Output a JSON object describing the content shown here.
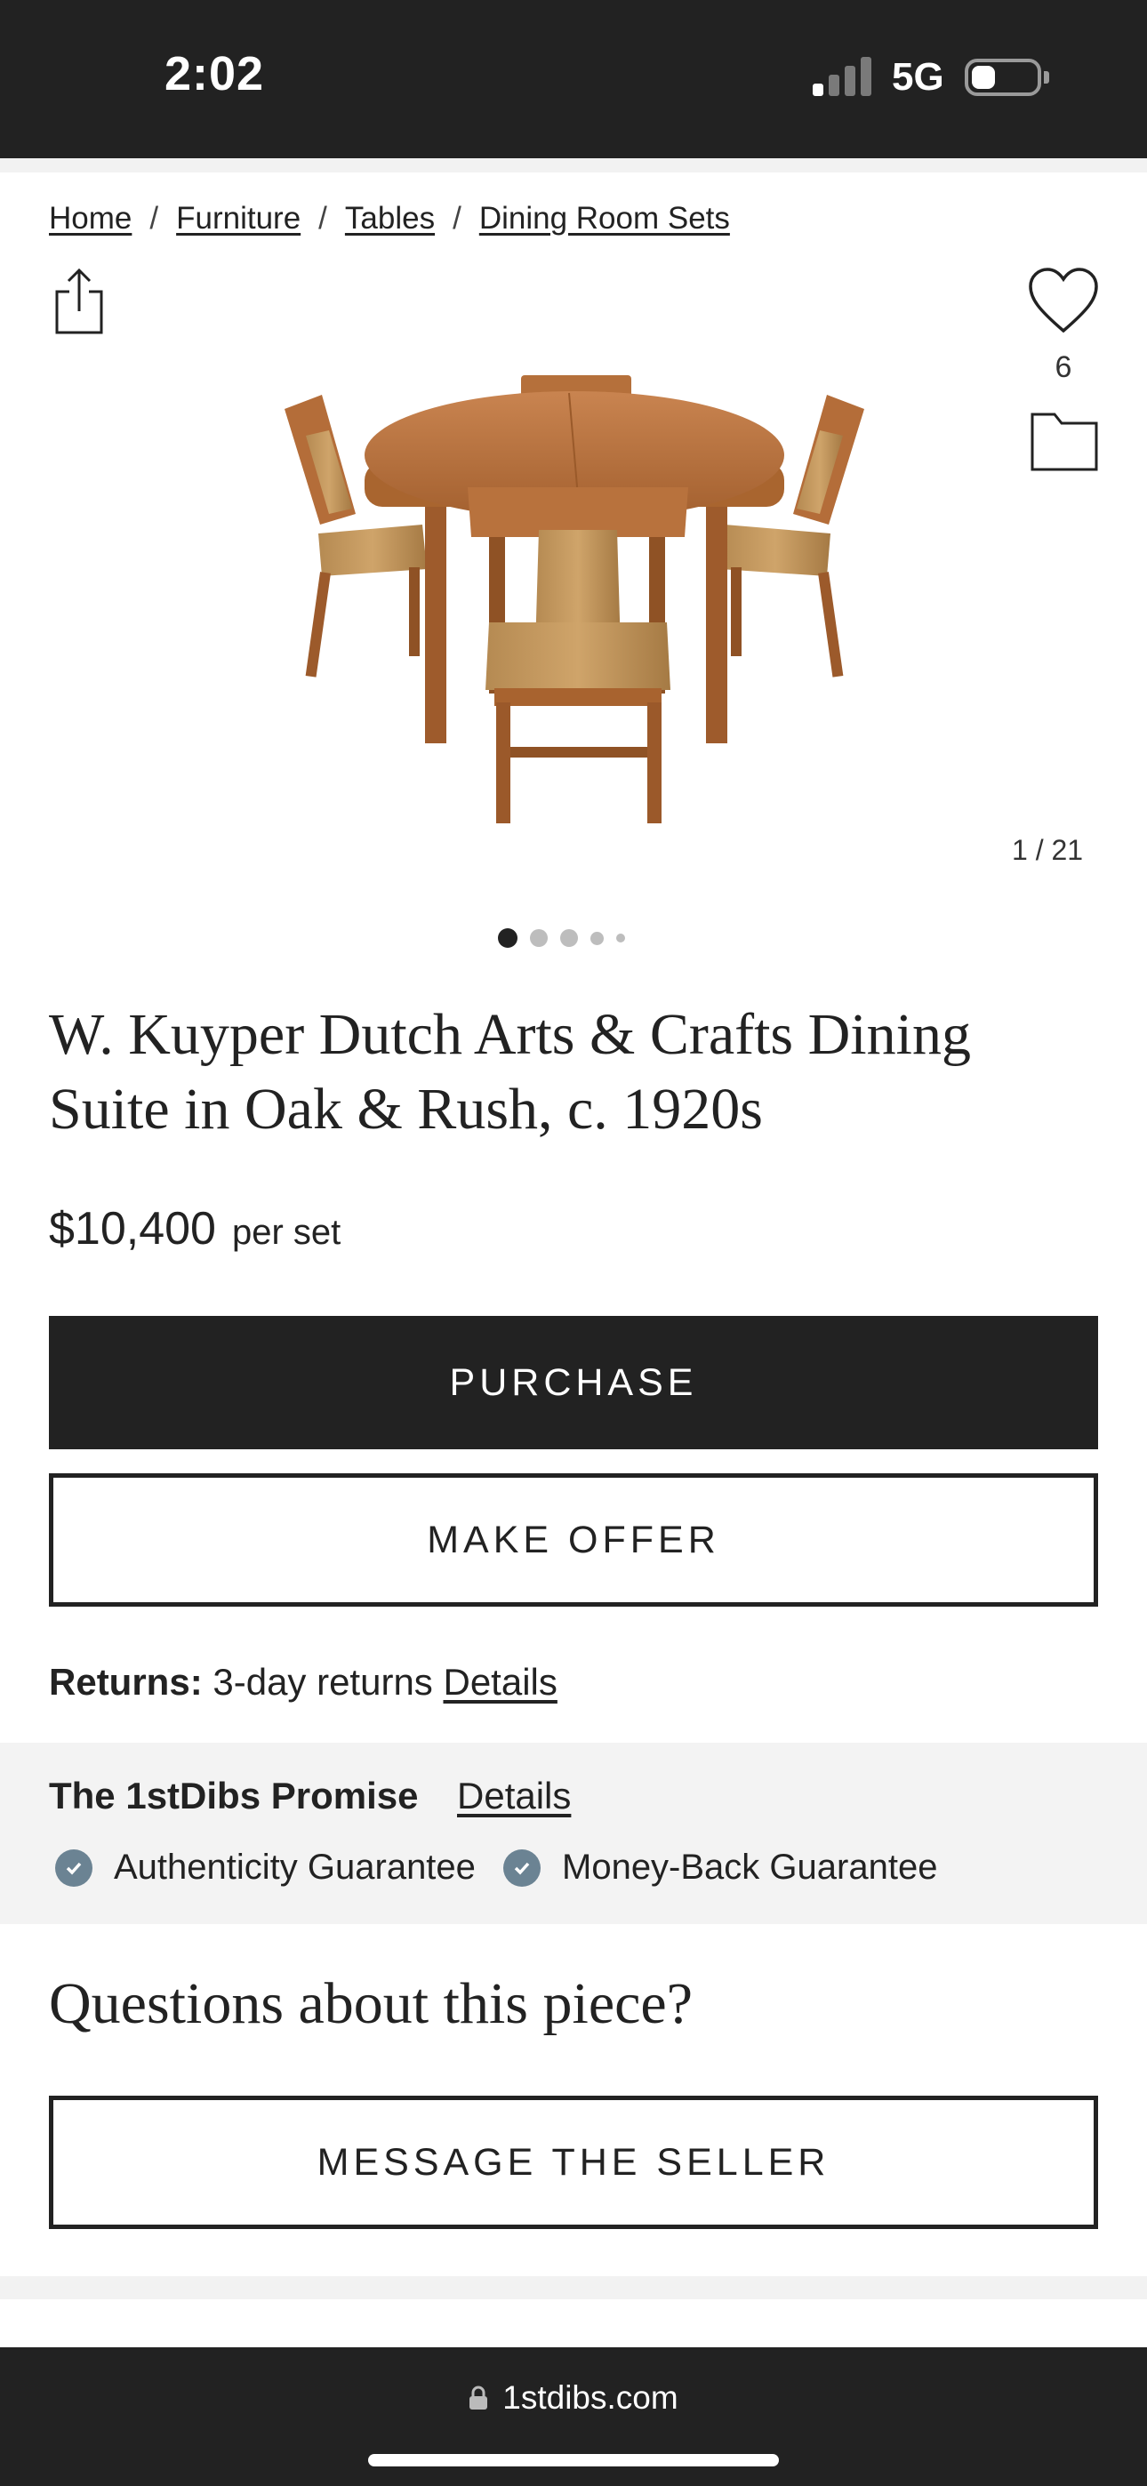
{
  "status_bar": {
    "time": "2:02",
    "network": "5G"
  },
  "breadcrumb": [
    "Home",
    "Furniture",
    "Tables",
    "Dining Room Sets"
  ],
  "breadcrumb_separator": "/",
  "gallery": {
    "favorites_count": "6",
    "image_counter": "1 / 21",
    "dots_count": 5,
    "active_dot": 1
  },
  "product": {
    "title": "W. Kuyper Dutch Arts & Crafts Dining Suite in Oak & Rush, c. 1920s",
    "price": "$10,400",
    "unit": "per set"
  },
  "actions": {
    "purchase": "PURCHASE",
    "offer": "MAKE OFFER",
    "message": "MESSAGE THE SELLER"
  },
  "returns": {
    "label": "Returns:",
    "text": "3-day returns",
    "link": "Details"
  },
  "promise": {
    "title": "The 1stDibs Promise",
    "link": "Details",
    "guarantees": [
      "Authenticity Guarantee",
      "Money-Back Guarantee"
    ]
  },
  "questions": {
    "heading": "Questions about this piece?"
  },
  "browser": {
    "url": "1stdibs.com"
  },
  "colors": {
    "dark": "#222222",
    "check": "#6b8393",
    "promise_bg": "#f3f3f3"
  },
  "icons": {
    "share": "share-icon",
    "favorite": "heart-icon",
    "folder": "folder-icon",
    "check": "check-icon",
    "lock": "lock-icon"
  }
}
